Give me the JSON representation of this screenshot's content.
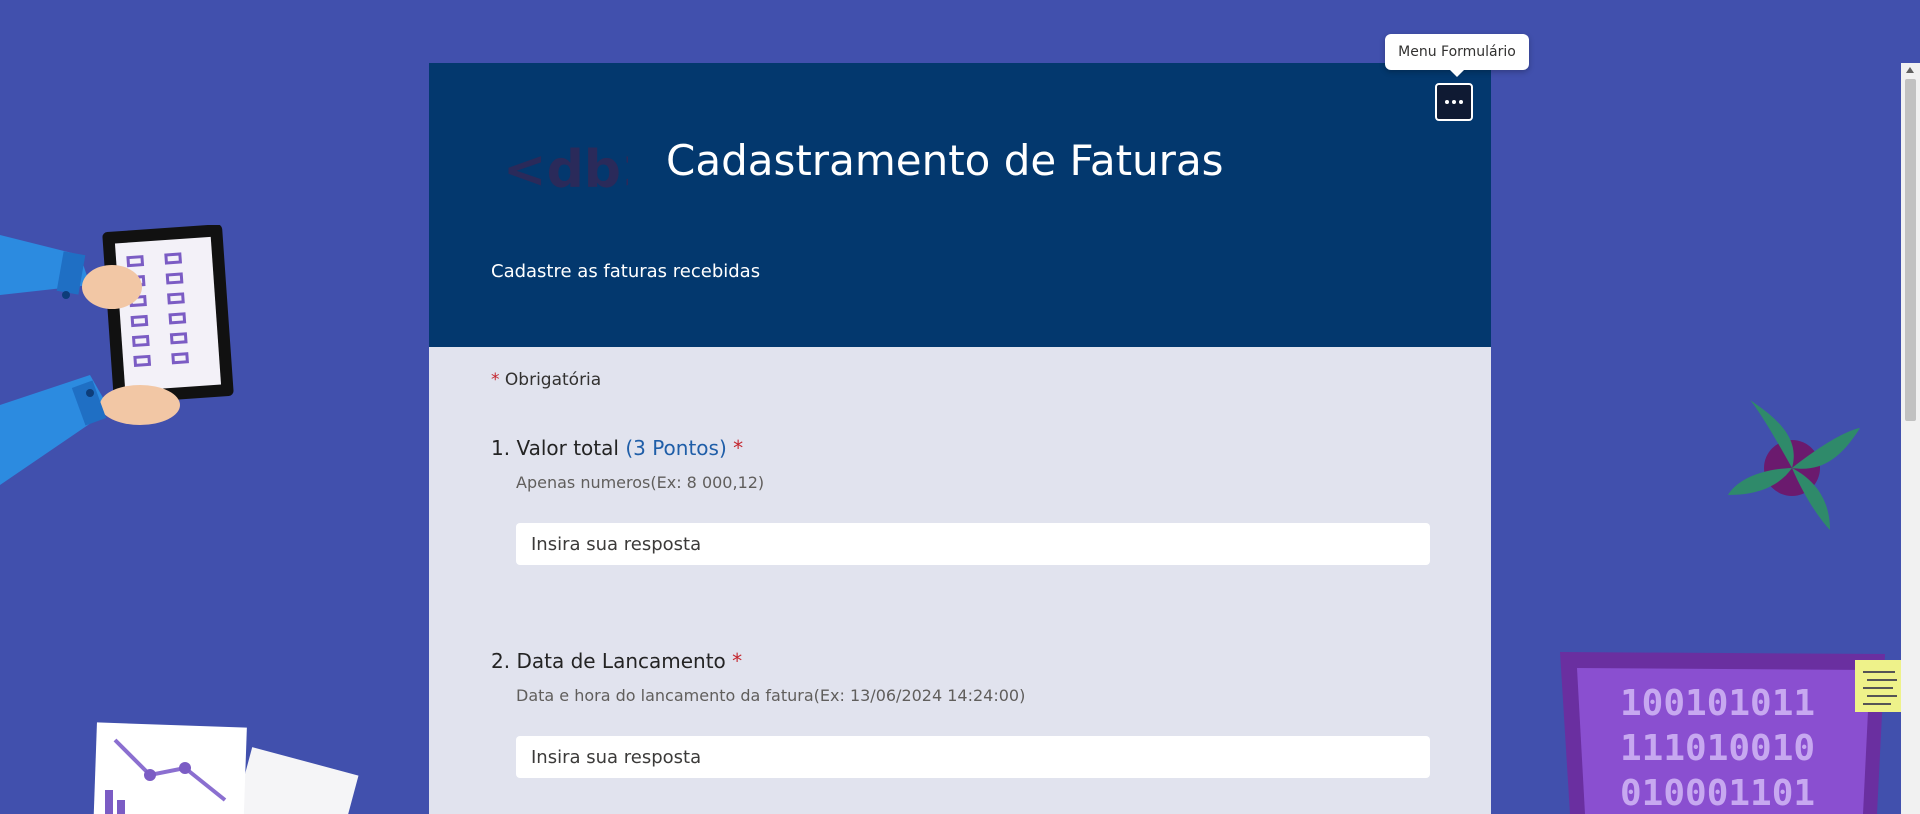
{
  "form": {
    "title": "Cadastramento de Faturas",
    "subtitle": "Cadastre as faturas recebidas",
    "required_note": "Obrigatória",
    "required_marker": "*",
    "logo_text": "<db>",
    "menu_icon": "more-horizontal-icon",
    "menu_tooltip": "Menu Formulário"
  },
  "questions": [
    {
      "number": "1.",
      "title": "Valor total",
      "points": "(3 Pontos)",
      "required": "*",
      "help": "Apenas numeros(Ex: 8 000,12)",
      "placeholder": "Insira sua resposta"
    },
    {
      "number": "2.",
      "title": "Data de Lancamento",
      "points": "",
      "required": "*",
      "help": "Data e hora do lancamento da fatura(Ex: 13/06/2024 14:24:00)",
      "placeholder": "Insira sua resposta"
    }
  ],
  "decorations": {
    "laptop_binary": [
      "100101011",
      "111010010",
      "010001101"
    ],
    "tablet_binary": [
      "10 10",
      "01 01",
      "10 10",
      "01 10",
      "10 01",
      "01 10"
    ]
  },
  "colors": {
    "background": "#4150ad",
    "header": "#03386e",
    "card_body": "#e1e3ee",
    "required": "#c4262e",
    "points": "#1f5ea8"
  }
}
